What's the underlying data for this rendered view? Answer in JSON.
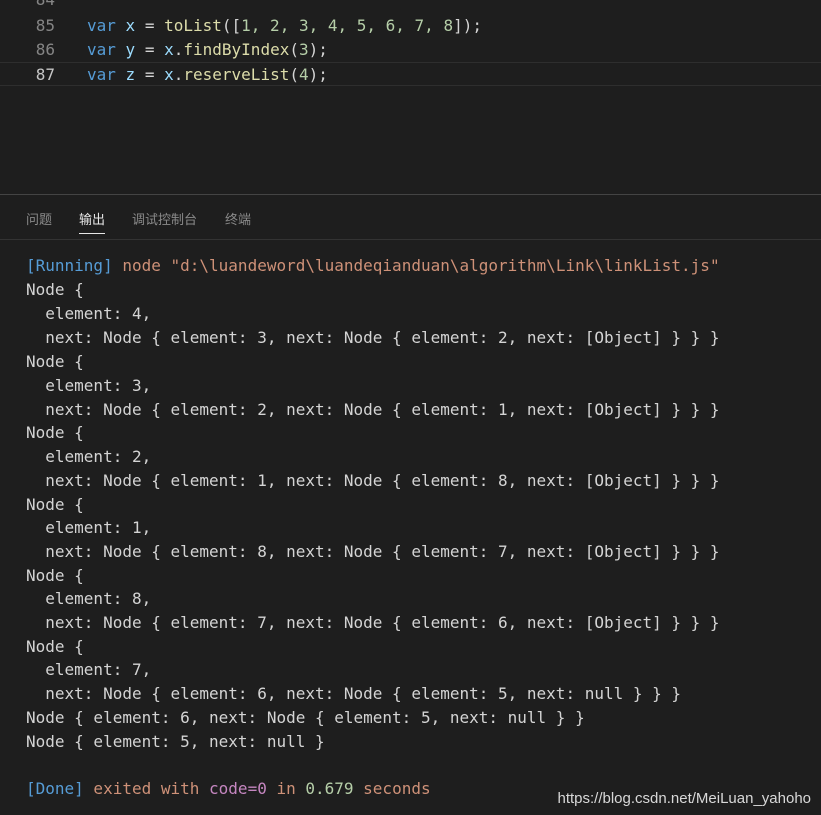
{
  "editor": {
    "partial_line_number": "84",
    "lines": [
      {
        "number": "85",
        "kw": "var",
        "name": "x",
        "eq": " = ",
        "fn": "toList",
        "open": "([",
        "args": "1, 2, 3, 4, 5, 6, 7, 8",
        "close": "]);"
      },
      {
        "number": "86",
        "kw": "var",
        "name": "y",
        "eq": " = ",
        "obj": "x",
        "dot": ".",
        "fn": "findByIndex",
        "open": "(",
        "args": "3",
        "close": ");"
      },
      {
        "number": "87",
        "kw": "var",
        "name": "z",
        "eq": " = ",
        "obj": "x",
        "dot": ".",
        "fn": "reserveList",
        "open": "(",
        "args": "4",
        "close": ");"
      }
    ]
  },
  "panel": {
    "tabs": [
      "问题",
      "输出",
      "调试控制台",
      "终端"
    ],
    "active_tab": "输出"
  },
  "output": {
    "running_tag": "[Running]",
    "running_cmd": " node \"d:\\luandeword\\luandeqianduan\\algorithm\\Link\\linkList.js\"",
    "lines": [
      "Node {",
      "  element: 4,",
      "  next: Node { element: 3, next: Node { element: 2, next: [Object] } } }",
      "Node {",
      "  element: 3,",
      "  next: Node { element: 2, next: Node { element: 1, next: [Object] } } }",
      "Node {",
      "  element: 2,",
      "  next: Node { element: 1, next: Node { element: 8, next: [Object] } } }",
      "Node {",
      "  element: 1,",
      "  next: Node { element: 8, next: Node { element: 7, next: [Object] } } }",
      "Node {",
      "  element: 8,",
      "  next: Node { element: 7, next: Node { element: 6, next: [Object] } } }",
      "Node {",
      "  element: 7,",
      "  next: Node { element: 6, next: Node { element: 5, next: null } } }",
      "Node { element: 6, next: Node { element: 5, next: null } }",
      "Node { element: 5, next: null }"
    ],
    "done_tag": "[Done]",
    "done_text1": " exited with ",
    "done_code": "code=0",
    "done_in": " in ",
    "done_time": "0.679",
    "done_text2": " seconds"
  },
  "watermark": "https://blog.csdn.net/MeiLuan_yahoho"
}
